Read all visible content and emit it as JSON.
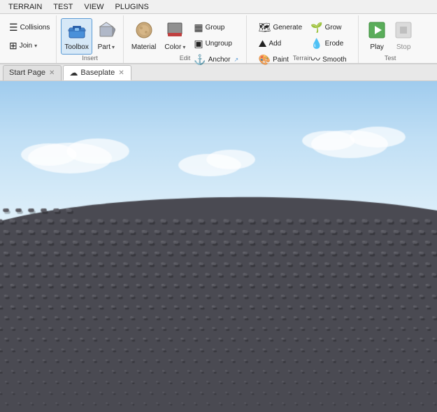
{
  "menuBar": {
    "items": [
      "TERRAIN",
      "TEST",
      "VIEW",
      "PLUGINS"
    ]
  },
  "ribbon": {
    "groups": [
      {
        "id": "left-partial",
        "label": "",
        "buttons": [
          {
            "id": "collisions",
            "label": "Collisions",
            "icon": "☰",
            "small": true
          },
          {
            "id": "join",
            "label": "Join",
            "icon": "⊞",
            "small": true,
            "hasDropdown": true
          }
        ]
      },
      {
        "id": "insert",
        "label": "Insert",
        "buttons": [
          {
            "id": "toolbox",
            "label": "Toolbox",
            "icon": "🧰",
            "large": true,
            "active": true
          },
          {
            "id": "part",
            "label": "Part",
            "icon": "⬛",
            "large": true,
            "hasDropdown": true
          }
        ]
      },
      {
        "id": "edit",
        "label": "Edit",
        "buttons": [
          {
            "id": "material",
            "label": "Material",
            "icon": "🪨",
            "large": true
          },
          {
            "id": "color",
            "label": "Color",
            "icon": "color-swatch",
            "large": true,
            "hasDropdown": true
          },
          {
            "id": "edit-small",
            "small_group": true,
            "items": [
              {
                "id": "group",
                "label": "Group",
                "icon": "▦"
              },
              {
                "id": "ungroup",
                "label": "Ungroup",
                "icon": "▣"
              },
              {
                "id": "anchor",
                "label": "Anchor",
                "icon": "⚓"
              }
            ]
          }
        ]
      },
      {
        "id": "terrain",
        "label": "Terrain",
        "buttons": [
          {
            "id": "terrain-small-1",
            "small_group": true,
            "items": [
              {
                "id": "generate",
                "label": "Generate",
                "icon": "🗺"
              },
              {
                "id": "add",
                "label": "Add",
                "icon": "⛰"
              },
              {
                "id": "paint",
                "label": "Paint",
                "icon": "🎨"
              }
            ]
          },
          {
            "id": "terrain-small-2",
            "small_group": true,
            "items": [
              {
                "id": "grow",
                "label": "Grow",
                "icon": "🌱"
              },
              {
                "id": "erode",
                "label": "Erode",
                "icon": "💧"
              },
              {
                "id": "smooth",
                "label": "Smooth",
                "icon": "〰"
              }
            ]
          }
        ]
      },
      {
        "id": "test",
        "label": "Test",
        "buttons": [
          {
            "id": "play",
            "label": "Play",
            "icon": "▶",
            "large": true
          },
          {
            "id": "stop",
            "label": "Stop",
            "icon": "⬛",
            "large": true,
            "disabled": true
          }
        ]
      }
    ]
  },
  "tabs": [
    {
      "id": "start-page",
      "label": "Start Page",
      "icon": "",
      "active": false,
      "closeable": true
    },
    {
      "id": "baseplate",
      "label": "Baseplate",
      "icon": "☁",
      "active": true,
      "closeable": true
    }
  ],
  "viewport": {
    "label": "3D Viewport"
  }
}
